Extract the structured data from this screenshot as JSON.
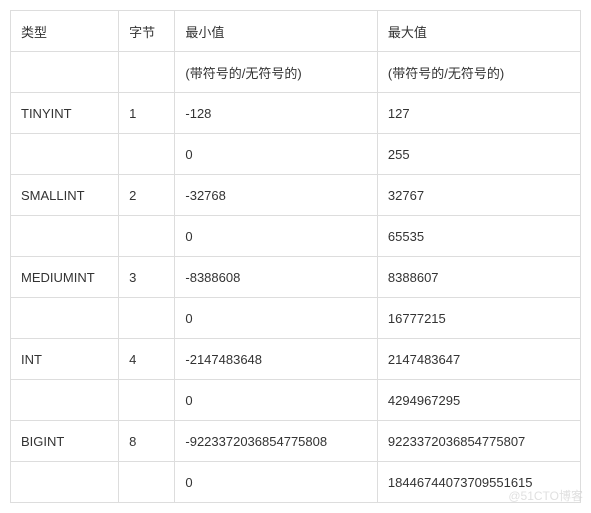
{
  "headers": {
    "type": "类型",
    "bytes": "字节",
    "min": "最小值",
    "max": "最大值"
  },
  "subheader": {
    "min": "(带符号的/无符号的)",
    "max": "(带符号的/无符号的)"
  },
  "rows": [
    {
      "type": "TINYINT",
      "bytes": "1",
      "min_signed": "-128",
      "max_signed": "127",
      "min_unsigned": "0",
      "max_unsigned": "255"
    },
    {
      "type": "SMALLINT",
      "bytes": "2",
      "min_signed": "-32768",
      "max_signed": "32767",
      "min_unsigned": "0",
      "max_unsigned": "65535"
    },
    {
      "type": "MEDIUMINT",
      "bytes": "3",
      "min_signed": "-8388608",
      "max_signed": "8388607",
      "min_unsigned": "0",
      "max_unsigned": "16777215"
    },
    {
      "type": "INT",
      "bytes": "4",
      "min_signed": "-2147483648",
      "max_signed": "2147483647",
      "min_unsigned": "0",
      "max_unsigned": "4294967295"
    },
    {
      "type": "BIGINT",
      "bytes": "8",
      "min_signed": "-9223372036854775808",
      "max_signed": "9223372036854775807",
      "min_unsigned": "0",
      "max_unsigned": "18446744073709551615"
    }
  ],
  "watermark": "@51CTO博客"
}
